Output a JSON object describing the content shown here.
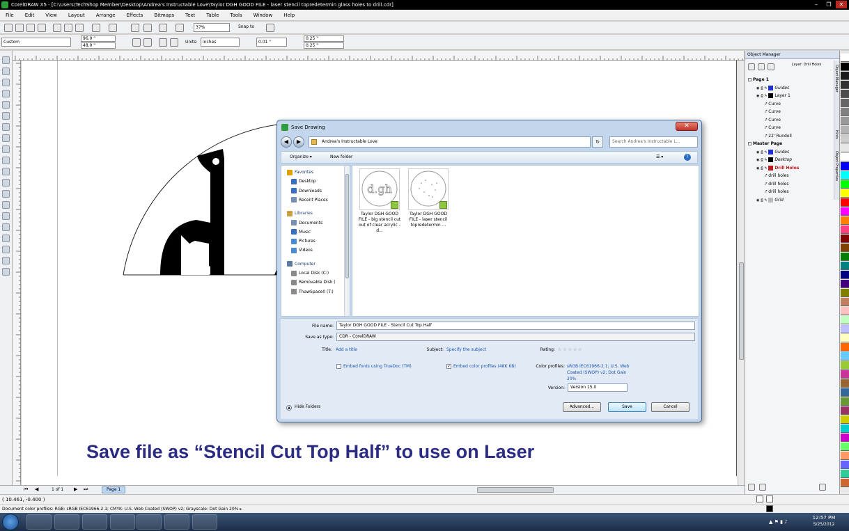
{
  "window": {
    "title": "CorelDRAW X5 - [C:\\Users\\TechShop Member\\Desktop\\Andrea's Instructable Love\\Taylor DGH GOOD FILE - laser stencil topredetermin glass holes to drill.cdr]",
    "min": "–",
    "max": "❐",
    "close": "✕"
  },
  "menu": [
    "File",
    "Edit",
    "View",
    "Layout",
    "Arrange",
    "Effects",
    "Bitmaps",
    "Text",
    "Table",
    "Tools",
    "Window",
    "Help"
  ],
  "toolbar": {
    "zoom": "37%",
    "snap_to": "Snap to"
  },
  "property_bar": {
    "paper": "Custom",
    "width": "96.0 \"",
    "height": "48.0 \"",
    "units_label": "Units:",
    "units": "inches",
    "nudge": "0.01 \"",
    "dup_x": "0.25 \"",
    "dup_y": "0.25 \""
  },
  "object_manager": {
    "title": "Object Manager",
    "layer_selector": "Layer: Drill Holes",
    "items": [
      {
        "label": "Page 1",
        "color": "",
        "indent": 0,
        "header": true
      },
      {
        "label": "Guides",
        "color": "#1f2fd6",
        "indent": 1,
        "italic": true
      },
      {
        "label": "Layer 1",
        "color": "#000000",
        "indent": 1
      },
      {
        "label": "Curve",
        "color": "",
        "indent": 2
      },
      {
        "label": "Curve",
        "color": "",
        "indent": 2
      },
      {
        "label": "Curve",
        "color": "",
        "indent": 2
      },
      {
        "label": "Curve",
        "color": "",
        "indent": 2
      },
      {
        "label": "22' Rundell",
        "color": "",
        "indent": 2
      },
      {
        "label": "Master Page",
        "color": "",
        "indent": 0,
        "header": true
      },
      {
        "label": "Guides",
        "color": "#1f2fd6",
        "indent": 1,
        "italic": true
      },
      {
        "label": "Desktop",
        "color": "#000000",
        "indent": 1,
        "italic": true
      },
      {
        "label": "Drill Holes",
        "color": "#c01818",
        "indent": 1,
        "red": true
      },
      {
        "label": "drill holes",
        "color": "",
        "indent": 2
      },
      {
        "label": "drill holes",
        "color": "",
        "indent": 2
      },
      {
        "label": "drill holes",
        "color": "",
        "indent": 2
      },
      {
        "label": "Grid",
        "color": "#bbbbbb",
        "indent": 1,
        "italic": true
      }
    ],
    "side_tabs": [
      "Object Manager",
      "Hints",
      "Object Properties"
    ]
  },
  "palette_colors": [
    "#ffffff",
    "#000000",
    "#1a1a1a",
    "#333333",
    "#4d4d4d",
    "#666666",
    "#808080",
    "#999999",
    "#b3b3b3",
    "#cccccc",
    "#e6e6e6",
    "#ffffff",
    "#0000ff",
    "#00ffff",
    "#00ff00",
    "#ffff00",
    "#ff0000",
    "#ff00ff",
    "#ff8000",
    "#ff4080",
    "#800000",
    "#804000",
    "#008000",
    "#008080",
    "#000080",
    "#400080",
    "#808000",
    "#c08060",
    "#ffc0c0",
    "#c0ffc0",
    "#c0c0ff",
    "#ffffc0",
    "#ff6600",
    "#66ccff",
    "#99cc33",
    "#cc3399",
    "#996633",
    "#336699",
    "#669933",
    "#993366",
    "#cccc00",
    "#00cccc",
    "#cc00cc",
    "#66ff66",
    "#ff9966",
    "#6666ff",
    "#33cc99",
    "#cc6633"
  ],
  "page_nav": {
    "count": "1 of 1",
    "tab": "Page 1"
  },
  "status": {
    "coords": "( 10.461, -0.400 )",
    "profile": "Document color profiles: RGB: sRGB IEC61966-2.1; CMYK: U.S. Web Coated (SWOP) v2; Grayscale: Dot Gain 20% ▸"
  },
  "dialog": {
    "title": "Save Drawing",
    "close": "✕",
    "address": "Andrea's Instructable Love",
    "search_placeholder": "Search Andrea's Instructable L...",
    "organize": "Organize ▾",
    "new_folder": "New folder",
    "nav": [
      {
        "label": "Favorites",
        "group": true,
        "icon": "star",
        "color": "#e0a000"
      },
      {
        "label": "Desktop",
        "icon": "desktop",
        "color": "#3a6fc0"
      },
      {
        "label": "Downloads",
        "icon": "download",
        "color": "#3a6fc0"
      },
      {
        "label": "Recent Places",
        "icon": "recent",
        "color": "#7a90b0"
      },
      {
        "label": "Libraries",
        "group": true,
        "icon": "library",
        "color": "#c8a040"
      },
      {
        "label": "Documents",
        "icon": "documents",
        "color": "#7a90b0"
      },
      {
        "label": "Music",
        "icon": "music",
        "color": "#3a6fc0"
      },
      {
        "label": "Pictures",
        "icon": "pictures",
        "color": "#4a8ad0"
      },
      {
        "label": "Videos",
        "icon": "videos",
        "color": "#4a8ad0"
      },
      {
        "label": "Computer",
        "group": true,
        "icon": "computer",
        "color": "#5a7aa0"
      },
      {
        "label": "Local Disk (C:)",
        "icon": "disk",
        "color": "#8a8a8a"
      },
      {
        "label": "Removable Disk (",
        "icon": "removable",
        "color": "#8a8a8a"
      },
      {
        "label": "ThawSpace0 (T:)",
        "icon": "disk",
        "color": "#8a8a8a"
      }
    ],
    "files": [
      {
        "name": "Taylor DGH GOOD FILE - big stencil cut out of clear acrylic - d...",
        "thumb_text": "d.gh"
      },
      {
        "name": "Taylor DGH GOOD FILE - laser stencil topredetermin ...",
        "thumb_text": ""
      }
    ],
    "file_name_label": "File name:",
    "file_name": "Taylor DGH GOOD FILE - Stencil Cut Top Half",
    "save_type_label": "Save as type:",
    "save_type": "CDR - CorelDRAW",
    "title_label": "Title:",
    "title_link": "Add a title",
    "subject_label": "Subject:",
    "subject_link": "Specify the subject",
    "rating_label": "Rating:",
    "rating": "☆ ☆ ☆ ☆ ☆",
    "embed_fonts": "Embed fonts using TrueDoc (TM)",
    "embed_profiles": "Embed color profiles (48K KB)",
    "embed_profiles_checked": true,
    "color_profiles_label": "Color profiles:",
    "color_profiles": "sRGB IEC61966-2.1; U.S. Web Coated (SWOP) v2; Dot Gain 20%",
    "version_label": "Version:",
    "version": "Version 15.0",
    "hide_folders": "Hide Folders",
    "advanced": "Advanced...",
    "save": "Save",
    "cancel": "Cancel"
  },
  "caption": "Save file as “Stencil Cut Top Half” to use on Laser",
  "clock": {
    "time": "12:57 PM",
    "date": "5/25/2012"
  }
}
